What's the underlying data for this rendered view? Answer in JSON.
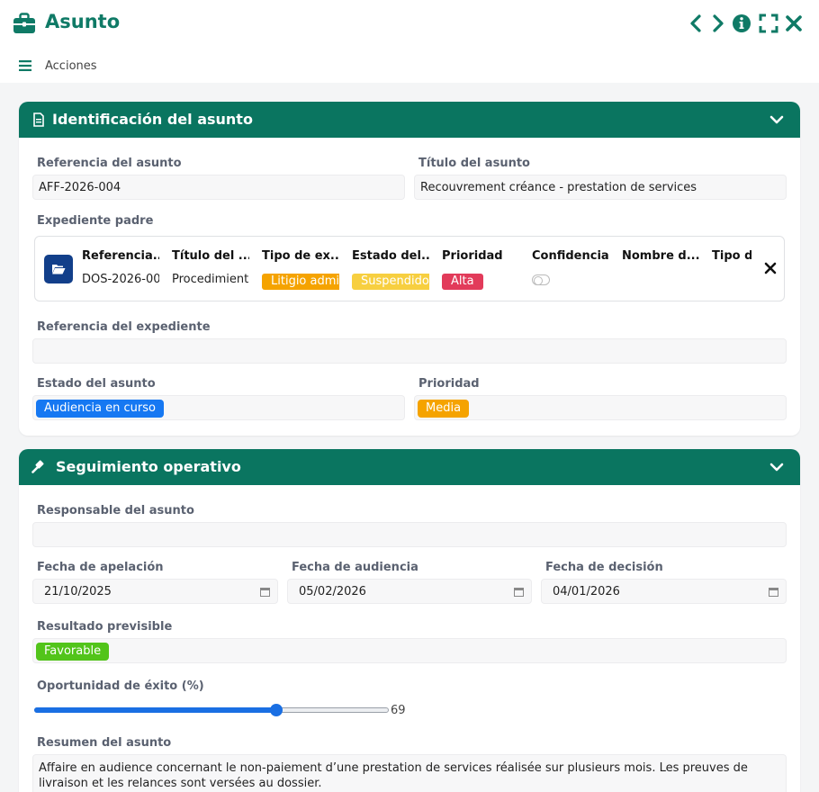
{
  "window": {
    "title": "Asunto",
    "icons": {
      "app": "briefcase-icon",
      "prev": "chevron-left-icon",
      "next": "chevron-right-icon",
      "info": "info-icon",
      "expand": "fullscreen-icon",
      "close": "close-icon"
    },
    "accent": "#0f7a66"
  },
  "actionbar": {
    "menu_label": "Acciones"
  },
  "identificacion": {
    "header": "Identificación del asunto",
    "header_color": "#0a7560",
    "referencia_label": "Referencia del asunto",
    "referencia_value": "AFF-2026-004",
    "titulo_label": "Título del asunto",
    "titulo_value": "Recouvrement créance - prestation de services",
    "expediente_padre_label": "Expediente padre",
    "expediente_table": {
      "headers": [
        "Referencia...",
        "Título del ...",
        "Tipo de ex...",
        "Estado del...",
        "Prioridad",
        "Confidencial",
        "Nombre d...",
        "Tipo de"
      ],
      "row": {
        "referencia": "DOS-2026-00",
        "titulo": "Procedimiento",
        "tipo": "Litigio admin",
        "estado": "Suspendido",
        "prioridad": "Alta"
      },
      "colors": {
        "tipo": "#f5a300",
        "estado": "#f7cf40",
        "prioridad": "#e23b5a",
        "folder": "#123f8a"
      }
    },
    "referencia_expediente_label": "Referencia del expediente",
    "referencia_expediente_value": "",
    "estado_label": "Estado del asunto",
    "estado_value": "Audiencia en curso",
    "estado_color": "#1678f2",
    "prioridad_label": "Prioridad",
    "prioridad_value": "Media",
    "prioridad_color": "#f5a300"
  },
  "seguimiento": {
    "header": "Seguimiento operativo",
    "responsable_label": "Responsable del asunto",
    "responsable_value": "",
    "fecha_apelacion_label": "Fecha de apelación",
    "fecha_apelacion_value": "21/10/2025",
    "fecha_audiencia_label": "Fecha de audiencia",
    "fecha_audiencia_value": "05/02/2026",
    "fecha_decision_label": "Fecha de decisión",
    "fecha_decision_value": "04/01/2026",
    "resultado_label": "Resultado previsible",
    "resultado_value": "Favorable",
    "resultado_color": "#52c41a",
    "oportunidad_label": "Oportunidad de éxito (%)",
    "oportunidad_value": "69",
    "oportunidad_fraction": 0.69,
    "slider_color": "#1a6fe3",
    "resumen_label": "Resumen del asunto",
    "resumen_value": "Affaire en audience concernant le non-paiement d’une prestation de services réalisée sur plusieurs mois. Les preuves de livraison et les relances sont versées au dossier."
  }
}
